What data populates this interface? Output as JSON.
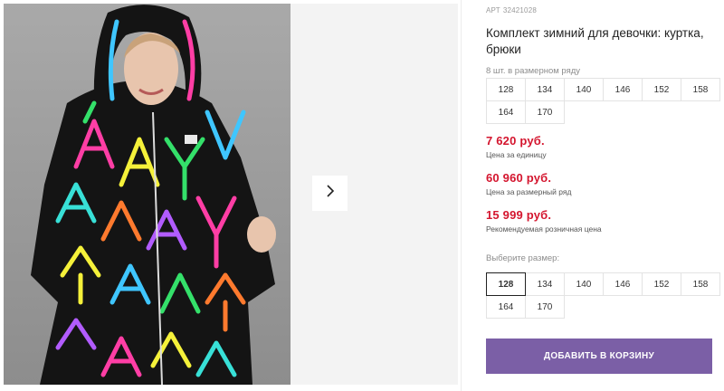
{
  "gallery": {
    "next_icon": "chevron-right-icon"
  },
  "product": {
    "article_prefix": "АРТ",
    "article_number": "32421028",
    "title": "Комплект зимний для девочки: куртка, брюки"
  },
  "size_range": {
    "caption": "8 шт. в размерном ряду",
    "sizes": [
      "128",
      "134",
      "140",
      "146",
      "152",
      "158",
      "164",
      "170"
    ]
  },
  "prices": {
    "unit_price": "7 620 руб.",
    "unit_label": "Цена за единицу",
    "range_price": "60 960 руб.",
    "range_label": "Цена за размерный ряд",
    "retail_price": "15 999 руб.",
    "retail_label": "Рекомендуемая розничная цена"
  },
  "size_select": {
    "caption": "Выберите размер:",
    "selected": "128",
    "sizes": [
      "128",
      "134",
      "140",
      "146",
      "152",
      "158",
      "164",
      "170"
    ]
  },
  "cart": {
    "add_label": "ДОБАВИТЬ В КОРЗИНУ"
  },
  "colors": {
    "price_red": "#d4152e",
    "button_purple": "#7b5fa6"
  }
}
